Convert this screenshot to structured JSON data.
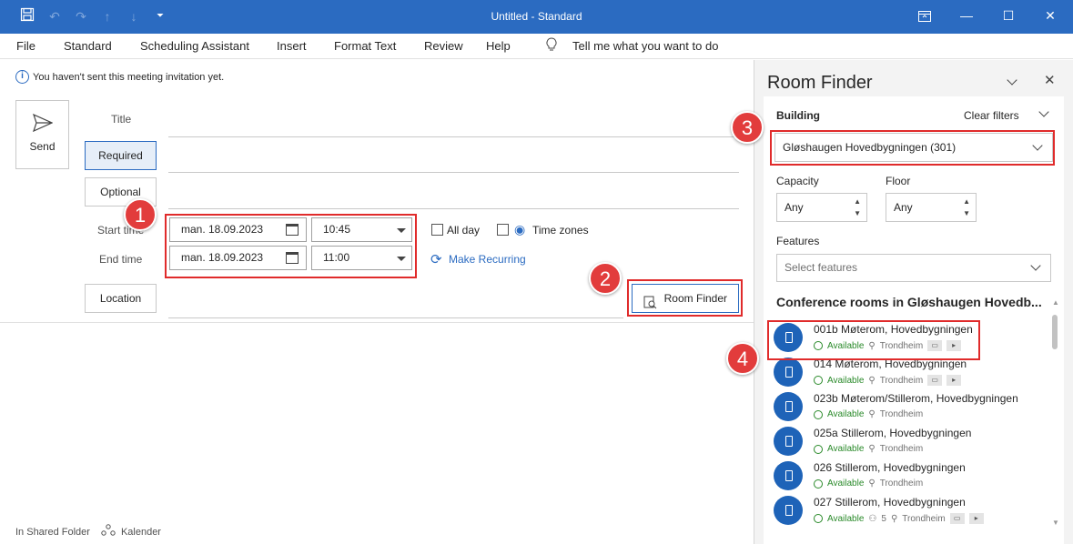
{
  "window": {
    "title": "Untitled  -  Standard",
    "accent": "#2b6bc1"
  },
  "menu": [
    "File",
    "Standard",
    "Scheduling Assistant",
    "Insert",
    "Format Text",
    "Review",
    "Help"
  ],
  "tell_me": "Tell me what you want to do",
  "info": "You haven't sent this meeting invitation yet.",
  "send": "Send",
  "form": {
    "title_label": "Title",
    "required": "Required",
    "optional": "Optional",
    "start_label": "Start time",
    "end_label": "End time",
    "location": "Location",
    "start_date": "man. 18.09.2023",
    "start_time": "10:45",
    "end_date": "man. 18.09.2023",
    "end_time": "11:00",
    "all_day": "All day",
    "time_zones": "Time zones",
    "make_recurring": "Make Recurring",
    "room_finder_btn": "Room Finder"
  },
  "footer": {
    "folder": "In Shared Folder",
    "calendar": "Kalender"
  },
  "badges": [
    "1",
    "2",
    "3",
    "4"
  ],
  "room_finder": {
    "title": "Room Finder",
    "building_label": "Building",
    "clear_filters": "Clear filters",
    "building_value": "Gløshaugen Hovedbygningen (301)",
    "capacity_label": "Capacity",
    "capacity_value": "Any",
    "floor_label": "Floor",
    "floor_value": "Any",
    "features_label": "Features",
    "features_placeholder": "Select features",
    "section_title": "Conference rooms in Gløshaugen Hovedb...",
    "rooms": [
      {
        "name": "001b Møterom, Hovedbygningen",
        "status": "Available",
        "location": "Trondheim",
        "capacity": ""
      },
      {
        "name": "014 Møterom, Hovedbygningen",
        "status": "Available",
        "location": "Trondheim",
        "capacity": ""
      },
      {
        "name": "023b Møterom/Stillerom, Hovedbygningen",
        "status": "Available",
        "location": "Trondheim",
        "capacity": ""
      },
      {
        "name": "025a Stillerom, Hovedbygningen",
        "status": "Available",
        "location": "Trondheim",
        "capacity": ""
      },
      {
        "name": "026 Stillerom, Hovedbygningen",
        "status": "Available",
        "location": "Trondheim",
        "capacity": ""
      },
      {
        "name": "027 Stillerom, Hovedbygningen",
        "status": "Available",
        "location": "Trondheim",
        "capacity": "5"
      }
    ]
  }
}
